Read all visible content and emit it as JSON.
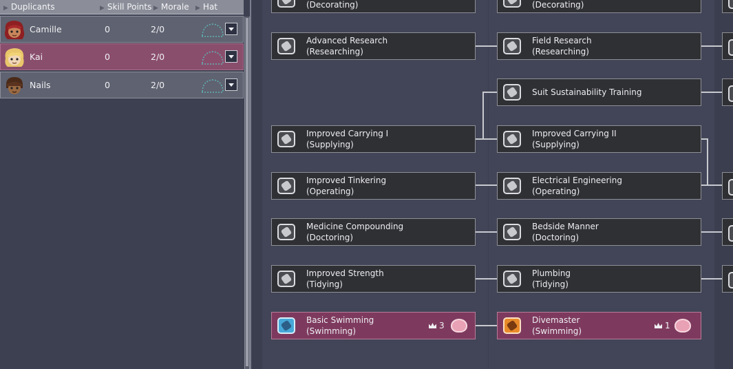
{
  "header": {
    "duplicants": "Duplicants",
    "skill_points": "Skill Points",
    "morale": "Morale",
    "hat": "Hat"
  },
  "duplicants": [
    {
      "name": "Camille",
      "skill_points": "0",
      "morale": "2/0",
      "avatar": "camille-avatar",
      "selected": false
    },
    {
      "name": "Kai",
      "skill_points": "0",
      "morale": "2/0",
      "avatar": "kai-avatar",
      "selected": true
    },
    {
      "name": "Nails",
      "skill_points": "0",
      "morale": "2/0",
      "avatar": "nails-avatar",
      "selected": false
    }
  ],
  "skills": {
    "col1": {
      "decorating": {
        "name": "(Decorating)",
        "icon": "decorating-icon"
      },
      "advanced_research": {
        "name": "Advanced Research",
        "group": "(Researching)",
        "icon": "research-icon"
      },
      "improved_carrying_1": {
        "name": "Improved Carrying I",
        "group": "(Supplying)",
        "icon": "carrying-icon"
      },
      "improved_tinkering": {
        "name": "Improved Tinkering",
        "group": "(Operating)",
        "icon": "operating-icon"
      },
      "medicine_compounding": {
        "name": "Medicine Compounding",
        "group": "(Doctoring)",
        "icon": "doctoring-icon"
      },
      "improved_strength": {
        "name": "Improved Strength",
        "group": "(Tidying)",
        "icon": "tidying-icon"
      },
      "basic_swimming": {
        "name": "Basic Swimming",
        "group": "(Swimming)",
        "icon": "swimming-icon",
        "level": "3"
      }
    },
    "col2": {
      "decorating": {
        "name": "(Decorating)",
        "icon": "decorating-icon"
      },
      "field_research": {
        "name": "Field Research",
        "group": "(Researching)",
        "icon": "research-icon"
      },
      "suit_sustainability": {
        "name": "Suit Sustainability Training",
        "icon": "suit-icon"
      },
      "improved_carrying_2": {
        "name": "Improved Carrying II",
        "group": "(Supplying)",
        "icon": "carrying-icon"
      },
      "electrical_engineering": {
        "name": "Electrical Engineering",
        "group": "(Operating)",
        "icon": "operating-icon"
      },
      "bedside_manner": {
        "name": "Bedside Manner",
        "group": "(Doctoring)",
        "icon": "doctoring-icon"
      },
      "plumbing": {
        "name": "Plumbing",
        "group": "(Tidying)",
        "icon": "tidying-icon"
      },
      "divemaster": {
        "name": "Divemaster",
        "group": "(Swimming)",
        "icon": "diving-icon",
        "level": "1"
      }
    }
  },
  "colors": {
    "selected_row": "#8a4e6d",
    "highlight_skill": "#7e3a5e",
    "swimming_icon": "#46a8d8",
    "diving_icon": "#e88a2a"
  }
}
